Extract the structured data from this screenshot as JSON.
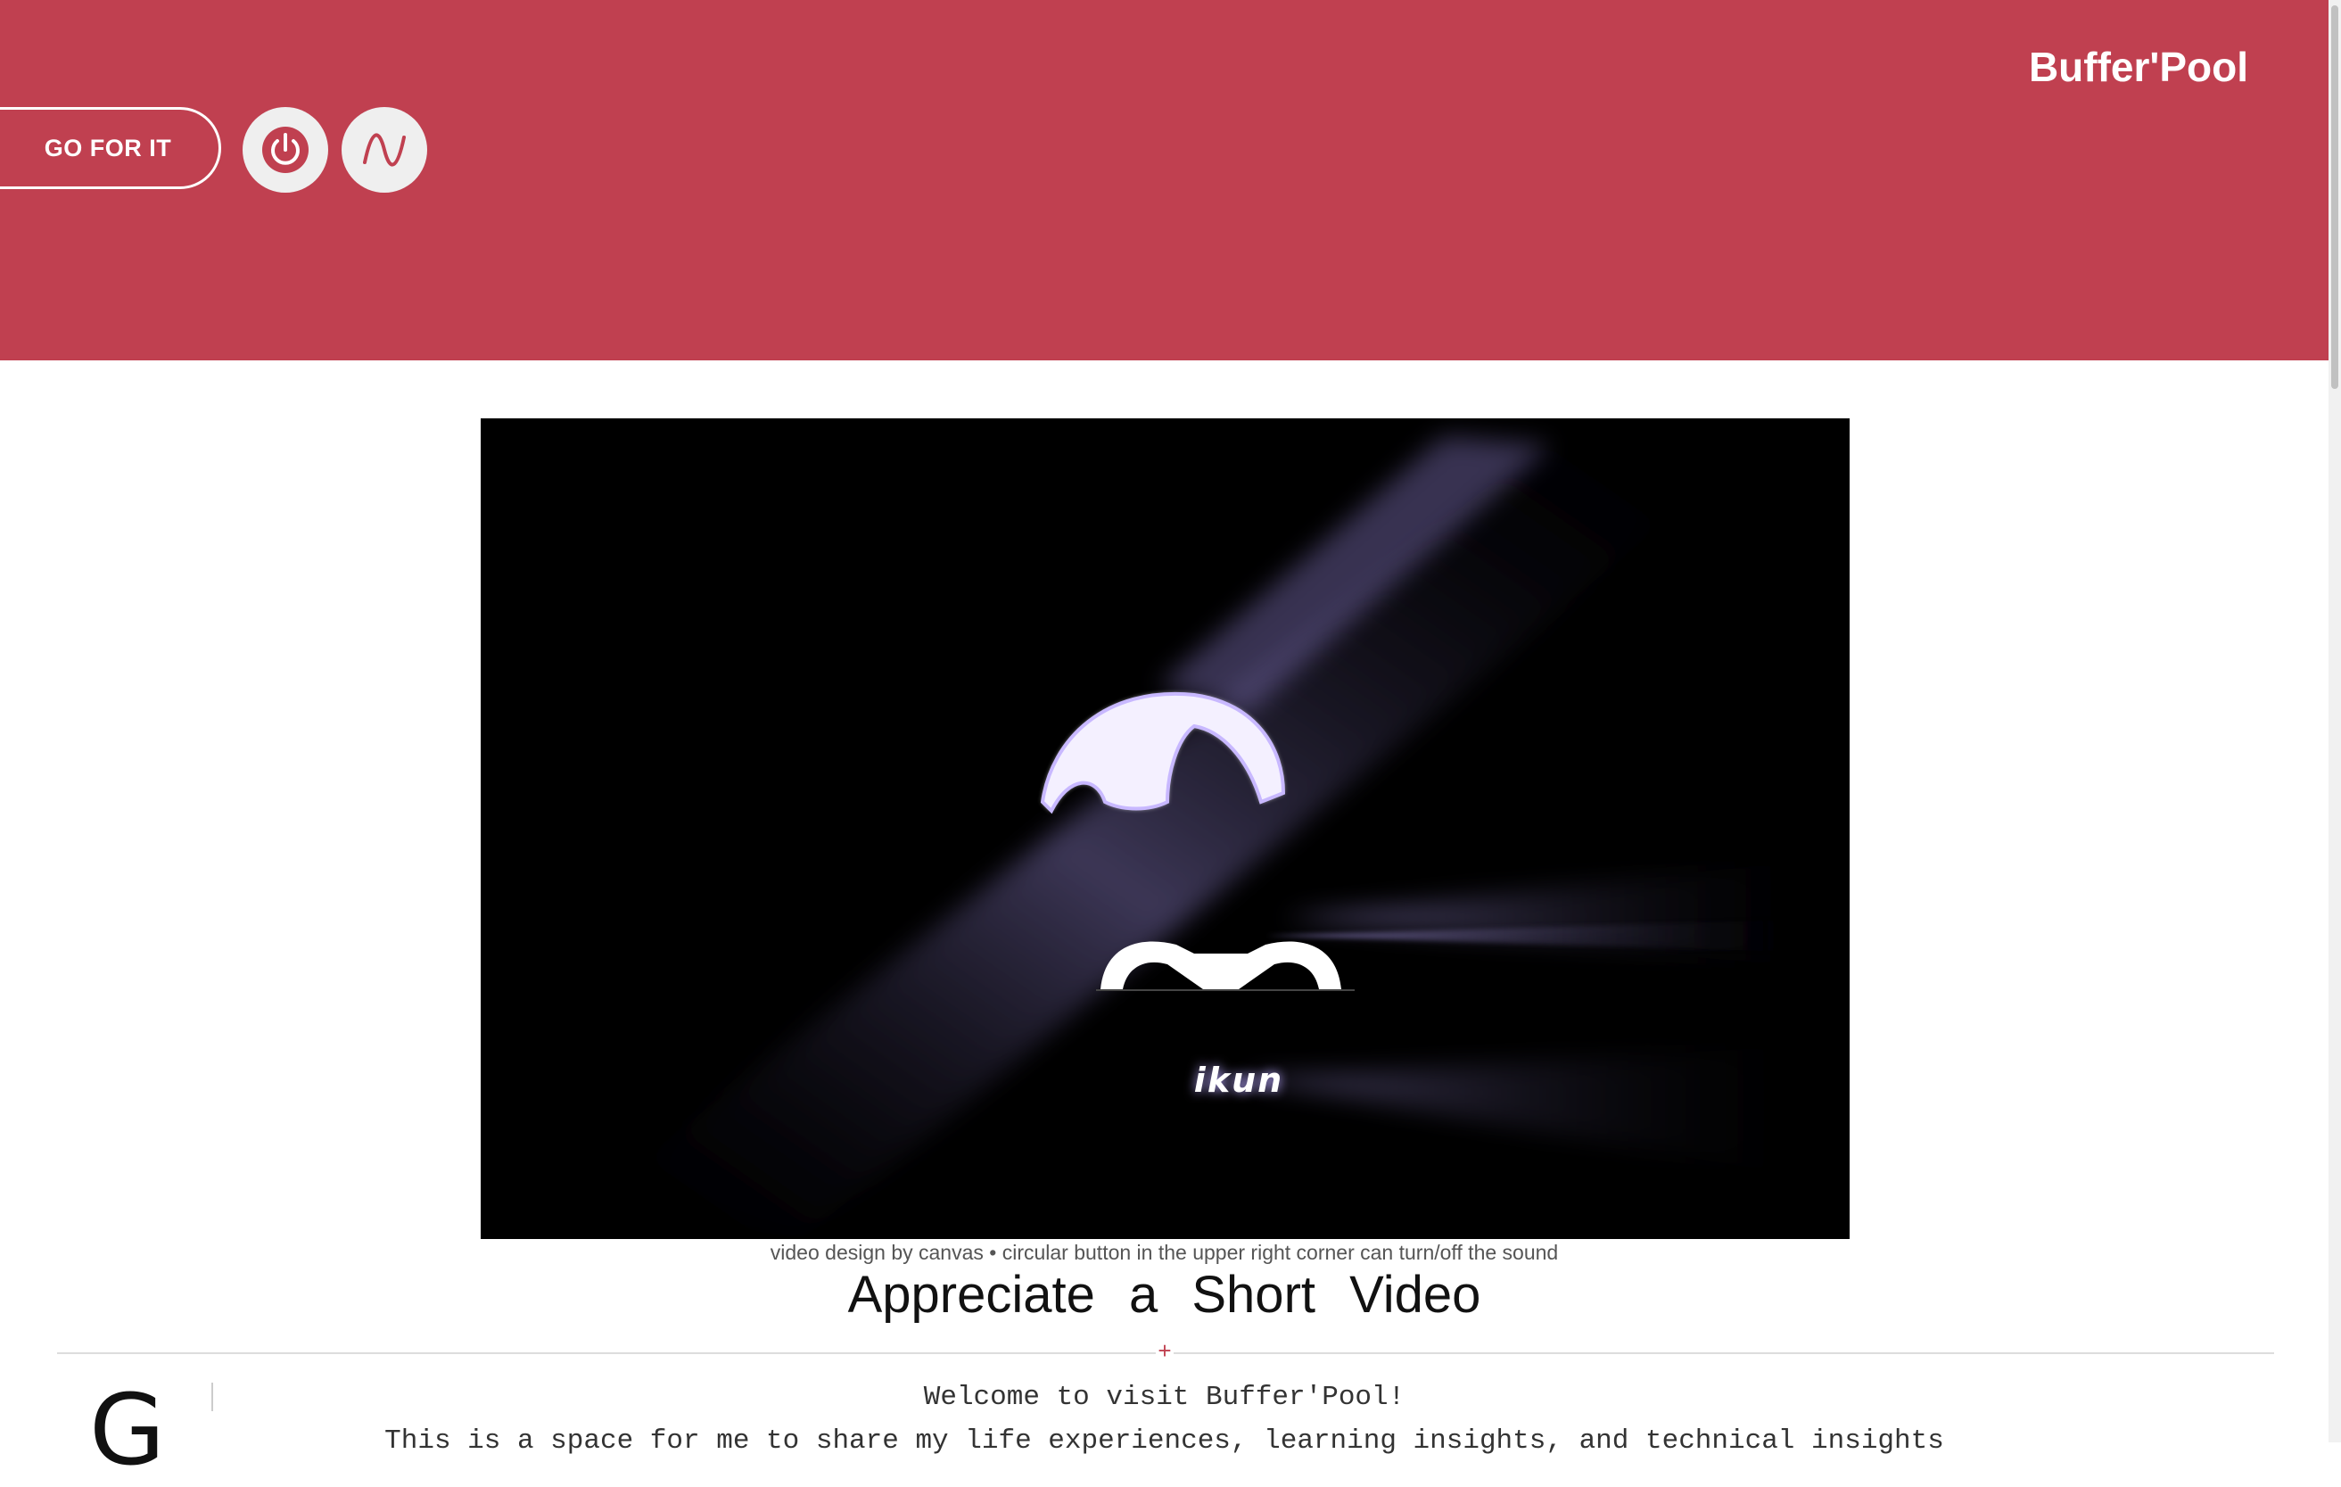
{
  "header": {
    "brand": "Buffer'Pool",
    "go_button_label": "GO FOR IT",
    "power_button_icon": "power-icon",
    "wave_button_icon": "sine-wave-icon",
    "background_color": "#c04050"
  },
  "video": {
    "overlay_text": "ikun",
    "caption": "video design by canvas • circular button in the upper right corner can turn/off the sound"
  },
  "main": {
    "title": "Appreciate a Short Video",
    "divider_symbol": "+",
    "drop_cap": "G",
    "welcome": "Welcome to visit Buffer'Pool!",
    "intro": "This is a space for me to share my life experiences, learning insights, and technical insights"
  },
  "colors": {
    "accent": "#c04050",
    "light_purple": "#b8a8ff"
  }
}
